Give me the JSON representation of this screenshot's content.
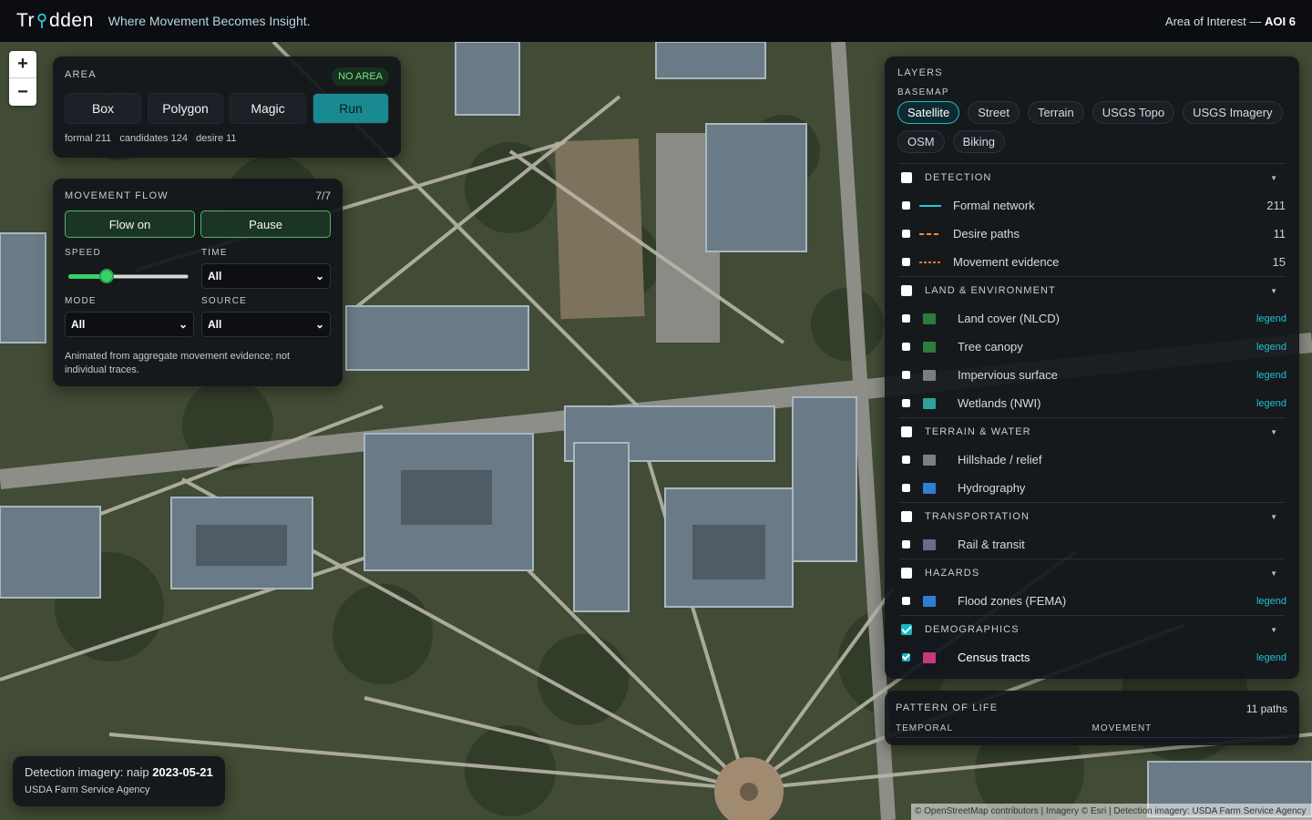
{
  "header": {
    "logo_text_a": "Tr",
    "logo_text_b": "dden",
    "tagline": "Where Movement Becomes Insight.",
    "aoi_prefix": "Area of Interest —",
    "aoi_value": "AOI 6"
  },
  "zoom": {
    "in": "+",
    "out": "−"
  },
  "area": {
    "title": "AREA",
    "badge": "NO AREA",
    "buttons": [
      "Box",
      "Polygon",
      "Magic",
      "Run"
    ],
    "stats": "formal 211   candidates 124   desire 11"
  },
  "flow": {
    "title": "MOVEMENT FLOW",
    "count": "7/7",
    "flow_on": "Flow on",
    "pause": "Pause",
    "speed_label": "SPEED",
    "speed_value": 0.3,
    "time_label": "TIME",
    "time_value": "All",
    "mode_label": "MODE",
    "mode_value": "All",
    "source_label": "SOURCE",
    "source_value": "All",
    "note": "Animated from aggregate movement evidence; not individual traces."
  },
  "layers": {
    "title": "LAYERS",
    "basemap_label": "BASEMAP",
    "basemaps": [
      "Satellite",
      "Street",
      "Terrain",
      "USGS Topo",
      "USGS Imagery",
      "OSM",
      "Biking"
    ],
    "selected_basemap": "Satellite",
    "groups": [
      {
        "name": "DETECTION",
        "checked": false,
        "items": [
          {
            "name": "Formal network",
            "count": "211",
            "kind": "line",
            "color": "#27c7d8",
            "style": "solid"
          },
          {
            "name": "Desire paths",
            "count": "11",
            "kind": "line",
            "color": "#f08a3c",
            "style": "dash"
          },
          {
            "name": "Movement evidence",
            "count": "15",
            "kind": "line",
            "color": "#e07a34",
            "style": "dot"
          }
        ]
      },
      {
        "name": "LAND & ENVIRONMENT",
        "checked": false,
        "items": [
          {
            "name": "Land cover (NLCD)",
            "legend": "legend",
            "color": "#2f7a3a"
          },
          {
            "name": "Tree canopy",
            "legend": "legend",
            "color": "#2e7c3b"
          },
          {
            "name": "Impervious surface",
            "legend": "legend",
            "color": "#7a7e82"
          },
          {
            "name": "Wetlands (NWI)",
            "legend": "legend",
            "color": "#2aa39a"
          }
        ]
      },
      {
        "name": "TERRAIN & WATER",
        "checked": false,
        "items": [
          {
            "name": "Hillshade / relief",
            "color": "#7b7f84"
          },
          {
            "name": "Hydrography",
            "color": "#2f7fd1"
          }
        ]
      },
      {
        "name": "TRANSPORTATION",
        "checked": false,
        "items": [
          {
            "name": "Rail & transit",
            "color": "#6a6c86"
          }
        ]
      },
      {
        "name": "HAZARDS",
        "checked": false,
        "items": [
          {
            "name": "Flood zones (FEMA)",
            "legend": "legend",
            "color": "#2f7fd1"
          }
        ]
      },
      {
        "name": "DEMOGRAPHICS",
        "checked": true,
        "items": [
          {
            "name": "Census tracts",
            "legend": "legend",
            "color": "#c43a7a",
            "checked": true
          }
        ]
      }
    ]
  },
  "pattern": {
    "title": "PATTERN OF LIFE",
    "paths": "11 paths",
    "temporal": "TEMPORAL",
    "movement": "MOVEMENT"
  },
  "detection": {
    "prefix": "Detection imagery: naip",
    "date": "2023-05-21",
    "agency": "USDA Farm Service Agency"
  },
  "attribution": "© OpenStreetMap contributors | Imagery © Esri | Detection imagery: USDA Farm Service Agency"
}
